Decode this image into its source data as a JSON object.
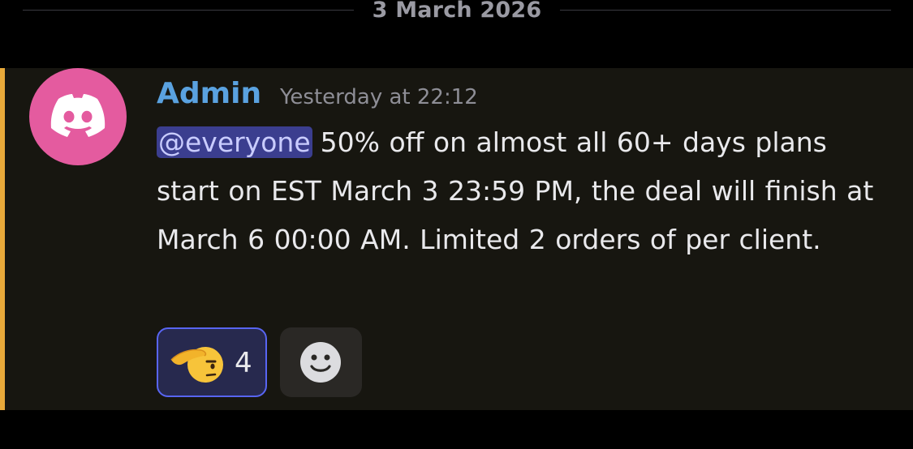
{
  "divider": {
    "date": "3 March 2026"
  },
  "message": {
    "author": "Admin",
    "author_color": "#5aa2e0",
    "timestamp": "Yesterday at 22:12",
    "mention": "@everyone",
    "text": "50% off on almost all 60+ days plans start on EST March 3  23:59 PM, the deal will finish at March 6 00:00 AM.  Limited 2 orders of per client.",
    "avatar_icon": "discord-logo-icon",
    "avatar_color": "#e45b9f",
    "highlight_bar_color": "#e8a93a"
  },
  "reactions": [
    {
      "emoji": "saluting-face-icon",
      "count": "4",
      "selected": true
    }
  ],
  "add_reaction": {
    "icon": "smiley-add-reaction-icon"
  }
}
